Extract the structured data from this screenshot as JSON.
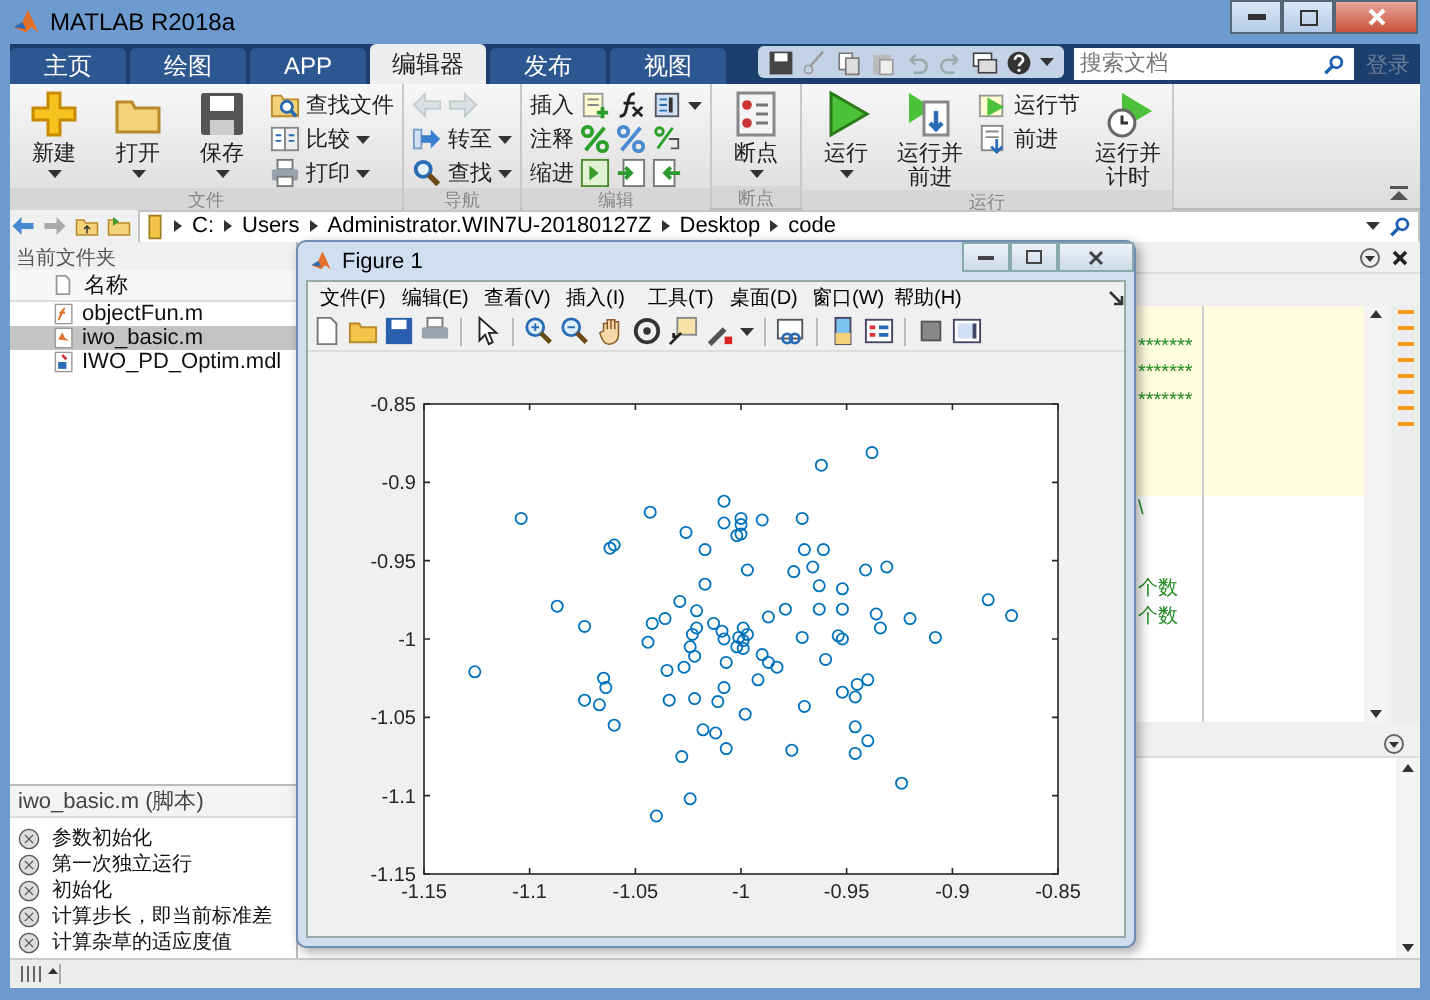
{
  "window": {
    "title": "MATLAB R2018a"
  },
  "tabs": [
    {
      "label": "主页",
      "selected": false
    },
    {
      "label": "绘图",
      "selected": false
    },
    {
      "label": "APP",
      "selected": false
    },
    {
      "label": "编辑器",
      "selected": true
    },
    {
      "label": "发布",
      "selected": false
    },
    {
      "label": "视图",
      "selected": false
    }
  ],
  "search": {
    "placeholder": "搜索文档"
  },
  "sign_in": "登录",
  "ribbon": {
    "groups": [
      {
        "label": "文件",
        "columns": [
          {
            "kind": "large",
            "label": "新建",
            "dropdown": true
          },
          {
            "kind": "large",
            "label": "打开",
            "dropdown": true
          },
          {
            "kind": "large",
            "label": "保存",
            "dropdown": true
          },
          {
            "kind": "stack",
            "items": [
              {
                "label": "查找文件",
                "dropdown": false
              },
              {
                "label": "比较",
                "dropdown": true
              },
              {
                "label": "打印",
                "dropdown": true
              }
            ]
          }
        ]
      },
      {
        "label": "导航",
        "columns": [
          {
            "kind": "stack",
            "items": [
              {
                "dropdown": false,
                "disabled": true
              },
              {
                "label": "转至",
                "dropdown": true
              },
              {
                "label": "查找",
                "dropdown": true
              }
            ]
          }
        ]
      },
      {
        "label": "编辑",
        "columns": [
          {
            "kind": "stack",
            "items": [
              {
                "label": "插入"
              },
              {
                "label": "注释"
              },
              {
                "label": "缩进"
              }
            ]
          }
        ]
      },
      {
        "label": "断点",
        "columns": [
          {
            "kind": "large",
            "label": "断点",
            "dropdown": true
          }
        ]
      },
      {
        "label": "运行",
        "columns": [
          {
            "kind": "large",
            "label": "运行",
            "dropdown": true
          },
          {
            "kind": "large",
            "label": "运行并前进",
            "dropdown": false
          },
          {
            "kind": "stack",
            "items": [
              {
                "label": "运行节",
                "dropdown": false
              },
              {
                "label": "前进",
                "dropdown": false
              }
            ]
          },
          {
            "kind": "large",
            "label": "运行并计时",
            "dropdown": false
          }
        ]
      }
    ]
  },
  "address_bar": {
    "path": [
      "C:",
      "Users",
      "Administrator.WIN7U-20180127Z",
      "Desktop",
      "code"
    ]
  },
  "current_folder": {
    "title": "当前文件夹",
    "column": "名称",
    "files": [
      {
        "name": "objectFun.m",
        "kind": "function",
        "selected": false
      },
      {
        "name": "iwo_basic.m",
        "kind": "script",
        "selected": true
      },
      {
        "name": "IWO_PD_Optim.mdl",
        "kind": "model",
        "selected": false
      }
    ]
  },
  "details": {
    "title": "iwo_basic.m (脚本)",
    "sections": [
      "参数初始化",
      "第一次独立运行",
      "初始化",
      "计算步长，即当前标准差",
      "计算杂草的适应度值"
    ]
  },
  "editor": {
    "lines": [
      {
        "highlighted": true
      },
      {
        "text": "*******",
        "highlighted": true
      },
      {
        "text": "*******",
        "highlighted": true
      },
      {
        "text": "*******",
        "highlighted": true
      },
      {
        "highlighted": true
      },
      {
        "highlighted": true
      },
      {
        "highlighted": true
      },
      {
        "text": "\\",
        "highlighted": false
      },
      {
        "highlighted": false
      },
      {
        "highlighted": false
      },
      {
        "text": "个数",
        "highlighted": false
      },
      {
        "text": "个数",
        "highlighted": false
      }
    ]
  },
  "figure": {
    "title": "Figure 1",
    "menu": [
      "文件(F)",
      "编辑(E)",
      "查看(V)",
      "插入(I)",
      "工具(T)",
      "桌面(D)",
      "窗口(W)",
      "帮助(H)"
    ],
    "chart_data": {
      "type": "scatter",
      "xlim": [
        -1.15,
        -0.85
      ],
      "ylim": [
        -1.15,
        -0.85
      ],
      "xticks": [
        -1.15,
        -1.1,
        -1.05,
        -1,
        -0.95,
        -0.9,
        -0.85
      ],
      "yticks": [
        -1.15,
        -1.1,
        -1.05,
        -1,
        -0.95,
        -0.9,
        -0.85
      ],
      "x": [
        -0.938,
        -0.962,
        -1.008,
        -1.104,
        -1.043,
        -1.026,
        -1.008,
        -1.0,
        -1.0,
        -0.99,
        -0.971,
        -1.002,
        -1.0,
        -1.062,
        -1.06,
        -1.017,
        -0.97,
        -0.961,
        -0.997,
        -0.975,
        -0.966,
        -0.941,
        -0.931,
        -1.017,
        -0.963,
        -0.952,
        -1.087,
        -1.029,
        -1.021,
        -0.979,
        -0.963,
        -0.952,
        -0.936,
        -1.074,
        -1.042,
        -1.036,
        -1.013,
        -1.021,
        -1.023,
        -1.009,
        -0.987,
        -0.999,
        -0.997,
        -0.92,
        -0.934,
        -0.883,
        -0.872,
        -0.908,
        -0.954,
        -0.952,
        -0.971,
        -1.008,
        -1.001,
        -0.999,
        -1.002,
        -0.999,
        -1.044,
        -1.024,
        -1.022,
        -0.99,
        -1.007,
        -0.987,
        -0.983,
        -0.96,
        -1.035,
        -1.027,
        -1.126,
        -1.065,
        -1.064,
        -1.008,
        -0.992,
        -0.94,
        -0.945,
        -0.952,
        -0.946,
        -1.074,
        -1.067,
        -1.034,
        -1.022,
        -1.011,
        -0.97,
        -1.06,
        -0.998,
        -1.018,
        -1.012,
        -0.946,
        -0.94,
        -1.007,
        -0.976,
        -0.946,
        -1.028,
        -0.924,
        -1.024,
        -1.04
      ],
      "series": [
        {
          "color": "#0072bd",
          "values": [
            -0.881,
            -0.889,
            -0.912,
            -0.923,
            -0.919,
            -0.932,
            -0.926,
            -0.923,
            -0.927,
            -0.924,
            -0.923,
            -0.934,
            -0.933,
            -0.942,
            -0.94,
            -0.943,
            -0.943,
            -0.943,
            -0.956,
            -0.957,
            -0.954,
            -0.956,
            -0.954,
            -0.965,
            -0.966,
            -0.968,
            -0.979,
            -0.976,
            -0.982,
            -0.981,
            -0.981,
            -0.981,
            -0.984,
            -0.992,
            -0.99,
            -0.987,
            -0.99,
            -0.993,
            -0.997,
            -0.995,
            -0.986,
            -0.993,
            -0.997,
            -0.987,
            -0.993,
            -0.975,
            -0.985,
            -0.999,
            -0.998,
            -1.0,
            -0.999,
            -1.0,
            -0.999,
            -1.001,
            -1.005,
            -1.006,
            -1.002,
            -1.005,
            -1.011,
            -1.01,
            -1.015,
            -1.015,
            -1.018,
            -1.013,
            -1.02,
            -1.018,
            -1.021,
            -1.025,
            -1.031,
            -1.031,
            -1.026,
            -1.026,
            -1.029,
            -1.034,
            -1.037,
            -1.039,
            -1.042,
            -1.039,
            -1.038,
            -1.04,
            -1.043,
            -1.055,
            -1.048,
            -1.058,
            -1.06,
            -1.056,
            -1.065,
            -1.07,
            -1.071,
            -1.073,
            -1.075,
            -1.092,
            -1.102,
            -1.113
          ]
        }
      ]
    }
  }
}
